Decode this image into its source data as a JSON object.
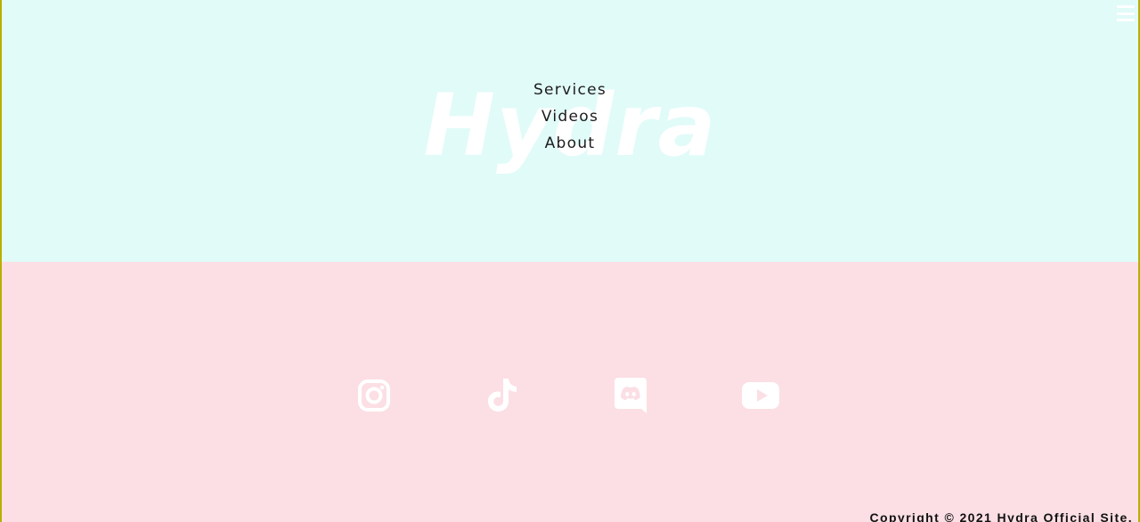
{
  "hero": {
    "brand": "Hydra"
  },
  "nav": {
    "items": [
      {
        "label": "Services"
      },
      {
        "label": "Videos"
      },
      {
        "label": "About"
      }
    ]
  },
  "socials": {
    "icons": [
      "instagram-icon",
      "tiktok-icon",
      "discord-icon",
      "youtube-icon"
    ]
  },
  "footer": {
    "copyright": "Copyright © 2021 Hydra Official Site."
  },
  "colors": {
    "hero_bg": "#e1fbf8",
    "footer_bg": "#fbdfe4",
    "icon": "#ffffff",
    "text": "#1c1c1c"
  }
}
